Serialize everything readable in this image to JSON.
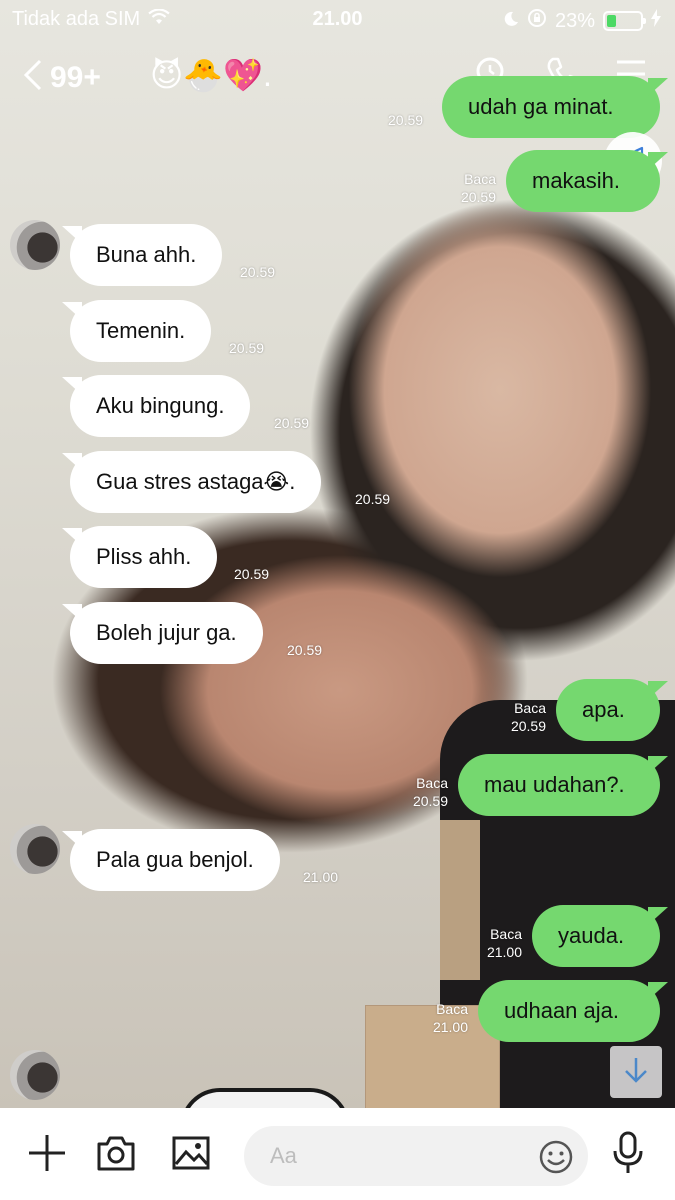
{
  "status_bar": {
    "carrier": "Tidak ada SIM",
    "time": "21.00",
    "battery_percent": "23%"
  },
  "header": {
    "unread_count": "99+",
    "chat_name": "😈🐣💖.",
    "icons": [
      "search-icon",
      "phone-icon",
      "menu-icon"
    ]
  },
  "messages": [
    {
      "side": "out",
      "text": "udah ga minat.",
      "read": "",
      "time": "20.59"
    },
    {
      "side": "out",
      "text": "makasih.",
      "read": "Baca",
      "time": "20.59"
    },
    {
      "side": "in",
      "text": "Buna ahh.",
      "time": "20.59"
    },
    {
      "side": "in",
      "text": "Temenin.",
      "time": "20.59"
    },
    {
      "side": "in",
      "text": "Aku bingung.",
      "time": "20.59"
    },
    {
      "side": "in",
      "text": "Gua stres astaga😭.",
      "time": "20.59"
    },
    {
      "side": "in",
      "text": "Pliss ahh.",
      "time": "20.59"
    },
    {
      "side": "in",
      "text": "Boleh jujur ga.",
      "time": "20.59"
    },
    {
      "side": "out",
      "text": "apa.",
      "read": "Baca",
      "time": "20.59"
    },
    {
      "side": "out",
      "text": "mau udahan?.",
      "read": "Baca",
      "time": "20.59"
    },
    {
      "side": "in",
      "text": "Pala gua benjol.",
      "time": "21.00"
    },
    {
      "side": "out",
      "text": "yauda.",
      "read": "Baca",
      "time": "21.00"
    },
    {
      "side": "out",
      "text": "udhaan aja.",
      "read": "Baca",
      "time": "21.00"
    }
  ],
  "composer": {
    "placeholder": "Aa"
  },
  "colors": {
    "outgoing_bubble": "#75d86f",
    "incoming_bubble": "#ffffff",
    "battery_fill": "#4cd964"
  }
}
